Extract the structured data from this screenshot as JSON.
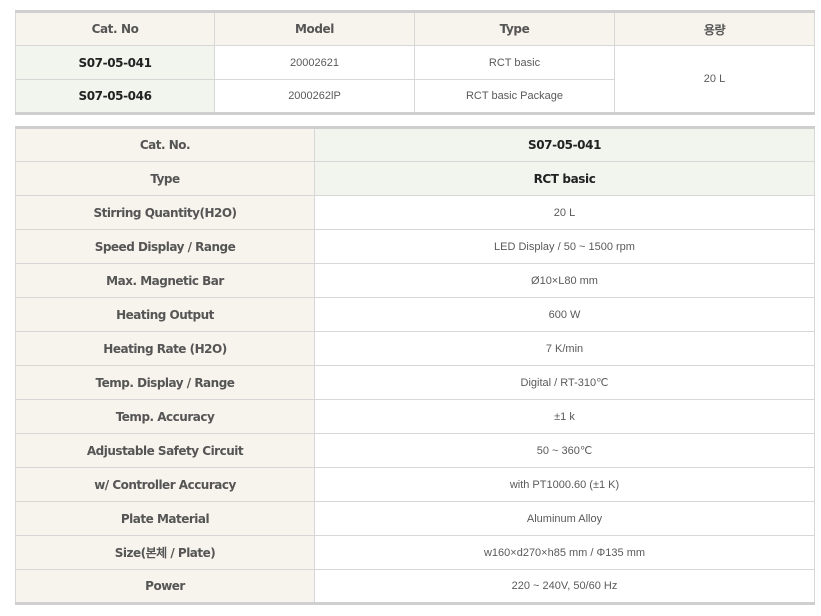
{
  "summary_table": {
    "headers": [
      "Cat. No",
      "Model",
      "Type",
      "용량"
    ],
    "rows": [
      {
        "cat_no": "S07-05-041",
        "model": "20002621",
        "type": "RCT basic"
      },
      {
        "cat_no": "S07-05-046",
        "model": "2000262lP",
        "type": "RCT basic Package"
      }
    ],
    "capacity": "20 L"
  },
  "spec_table": {
    "rows": [
      {
        "label": "Cat. No.",
        "value": "S07-05-041"
      },
      {
        "label": "Type",
        "value": "RCT basic"
      },
      {
        "label": "Stirring Quantity(H2O)",
        "value": "20 L"
      },
      {
        "label": "Speed Display / Range",
        "value": "LED Display / 50 ~ 1500 rpm"
      },
      {
        "label": "Max. Magnetic Bar",
        "value": "Ø10×L80 mm"
      },
      {
        "label": "Heating Output",
        "value": "600 W"
      },
      {
        "label": "Heating Rate (H2O)",
        "value": "7 K/min"
      },
      {
        "label": "Temp. Display / Range",
        "value": "Digital / RT-310℃"
      },
      {
        "label": "Temp. Accuracy",
        "value": "±1 k"
      },
      {
        "label": "Adjustable Safety Circuit",
        "value": "50 ~ 360℃"
      },
      {
        "label": "w/ Controller Accuracy",
        "value": "with PT1000.60 (±1 K)"
      },
      {
        "label": "Plate Material",
        "value": "Aluminum Alloy"
      },
      {
        "label": "Size(본체 / Plate)",
        "value": "w160×d270×h85 mm / Φ135 mm"
      },
      {
        "label": "Power",
        "value": "220 ~ 240V, 50/60 Hz"
      }
    ]
  }
}
